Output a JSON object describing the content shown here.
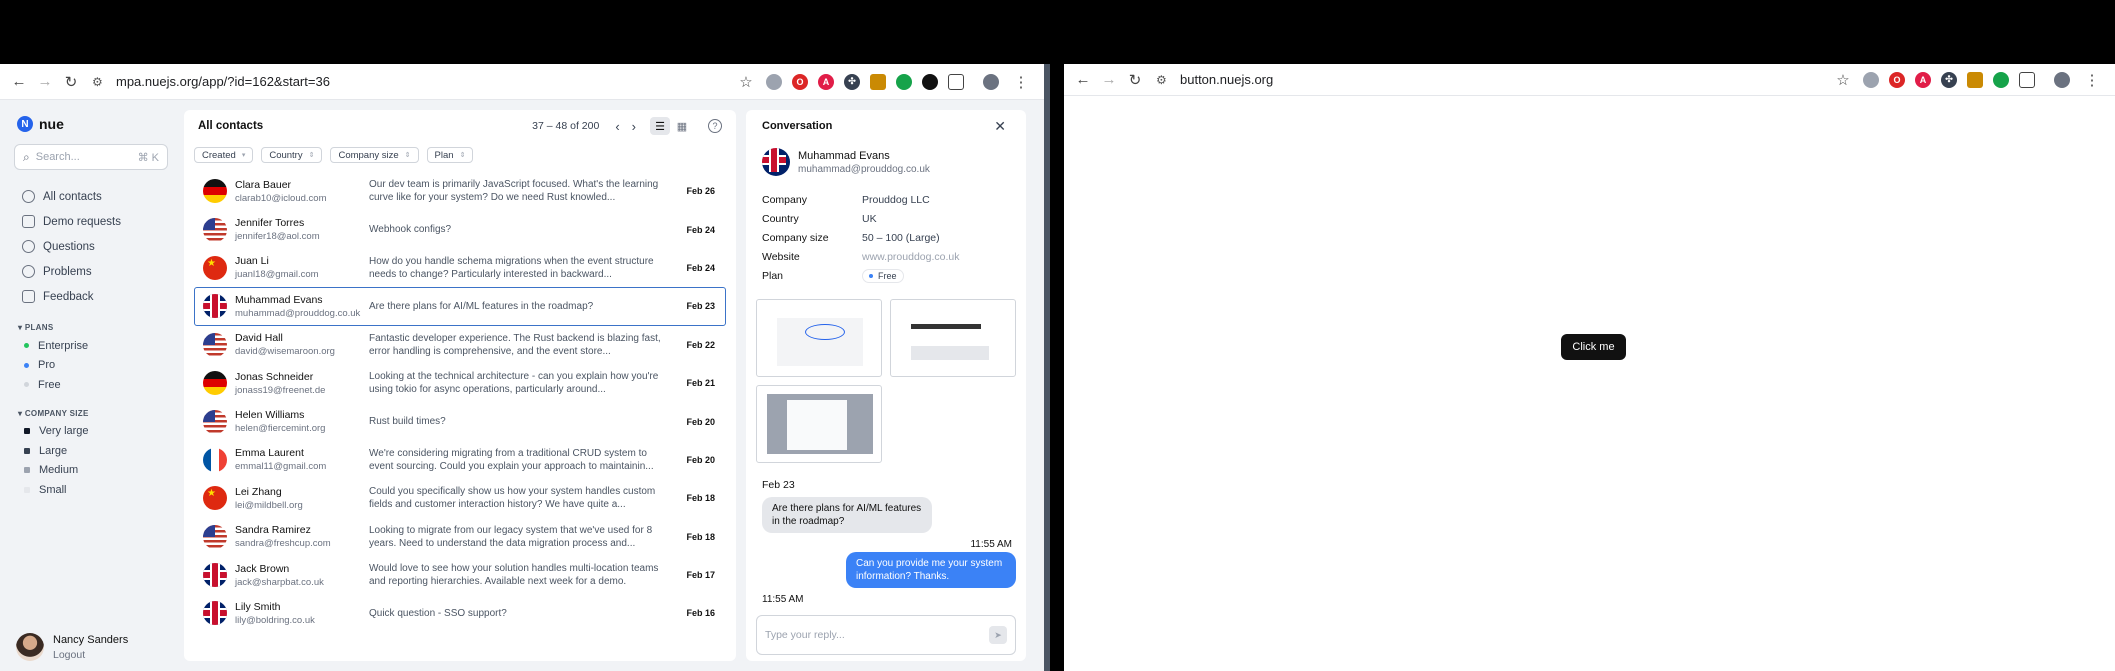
{
  "left_browser": {
    "url": "mpa.nuejs.org/app/?id=162&start=36"
  },
  "right_browser": {
    "url": "button.nuejs.org",
    "button_label": "Click me"
  },
  "sidebar": {
    "logo": "nue",
    "search_placeholder": "Search...",
    "search_shortcut": "⌘ K",
    "nav": [
      {
        "label": "All contacts"
      },
      {
        "label": "Demo requests"
      },
      {
        "label": "Questions"
      },
      {
        "label": "Problems"
      },
      {
        "label": "Feedback"
      }
    ],
    "plans_title": "PLANS",
    "plans": [
      {
        "label": "Enterprise",
        "color": "#22c55e"
      },
      {
        "label": "Pro",
        "color": "#3b82f6"
      },
      {
        "label": "Free",
        "color": "#d1d5db"
      }
    ],
    "size_title": "COMPANY SIZE",
    "sizes": [
      {
        "label": "Very large",
        "color": "#111827"
      },
      {
        "label": "Large",
        "color": "#374151"
      },
      {
        "label": "Medium",
        "color": "#9ca3af"
      },
      {
        "label": "Small",
        "color": "#e5e7eb"
      }
    ],
    "user": {
      "name": "Nancy Sanders",
      "logout": "Logout"
    }
  },
  "list": {
    "title": "All contacts",
    "range": "37 – 48 of 200",
    "filters": [
      "Created",
      "Country",
      "Company size",
      "Plan"
    ],
    "rows": [
      {
        "flag": "de",
        "name": "Clara Bauer",
        "email": "clarab10@icloud.com",
        "message": "Our dev team is primarily JavaScript focused. What's the learning curve like for your system? Do we need Rust knowled...",
        "date": "Feb 26"
      },
      {
        "flag": "us",
        "name": "Jennifer Torres",
        "email": "jennifer18@aol.com",
        "message": "Webhook configs?",
        "date": "Feb 24"
      },
      {
        "flag": "cn",
        "name": "Juan Li",
        "email": "juanl18@gmail.com",
        "message": "How do you handle schema migrations when the event structure needs to change? Particularly interested in backward...",
        "date": "Feb 24"
      },
      {
        "flag": "uk",
        "name": "Muhammad Evans",
        "email": "muhammad@prouddog.co.uk",
        "message": "Are there plans for AI/ML features in the roadmap?",
        "date": "Feb 23",
        "selected": true
      },
      {
        "flag": "us",
        "name": "David Hall",
        "email": "david@wisemaroon.org",
        "message": "Fantastic developer experience. The Rust backend is blazing fast, error handling is comprehensive, and the event store...",
        "date": "Feb 22"
      },
      {
        "flag": "de",
        "name": "Jonas Schneider",
        "email": "jonass19@freenet.de",
        "message": "Looking at the technical architecture - can you explain how you're using tokio for async operations, particularly around...",
        "date": "Feb 21"
      },
      {
        "flag": "us",
        "name": "Helen Williams",
        "email": "helen@fiercemint.org",
        "message": "Rust build times?",
        "date": "Feb 20"
      },
      {
        "flag": "fr",
        "name": "Emma Laurent",
        "email": "emmal11@gmail.com",
        "message": "We're considering migrating from a traditional CRUD system to event sourcing. Could you explain your approach to maintainin...",
        "date": "Feb 20"
      },
      {
        "flag": "cn",
        "name": "Lei Zhang",
        "email": "lei@mildbell.org",
        "message": "Could you specifically show us how your system handles custom fields and customer interaction history? We have quite a...",
        "date": "Feb 18"
      },
      {
        "flag": "us",
        "name": "Sandra Ramirez",
        "email": "sandra@freshcup.com",
        "message": "Looking to migrate from our legacy system that we've used for 8 years. Need to understand the data migration process and...",
        "date": "Feb 18"
      },
      {
        "flag": "uk",
        "name": "Jack Brown",
        "email": "jack@sharpbat.co.uk",
        "message": "Would love to see how your solution handles multi-location teams and reporting hierarchies. Available next week for a demo.",
        "date": "Feb 17"
      },
      {
        "flag": "uk",
        "name": "Lily Smith",
        "email": "lily@boldring.co.uk",
        "message": "Quick question - SSO support?",
        "date": "Feb 16"
      }
    ]
  },
  "conversation": {
    "title": "Conversation",
    "name": "Muhammad Evans",
    "email": "muhammad@prouddog.co.uk",
    "fields": [
      {
        "key": "Company",
        "value": "Prouddog LLC"
      },
      {
        "key": "Country",
        "value": "UK"
      },
      {
        "key": "Company size",
        "value": "50 – 100 (Large)"
      },
      {
        "key": "Website",
        "value": "www.prouddog.co.uk"
      }
    ],
    "plan_key": "Plan",
    "plan_value": "Free",
    "day": "Feb 23",
    "incoming": "Are there plans for AI/ML features in the roadmap?",
    "time": "11:55 AM",
    "outgoing": "Can you provide me your system information? Thanks.",
    "cut_time": "11:55 AM",
    "reply_placeholder": "Type your reply..."
  }
}
